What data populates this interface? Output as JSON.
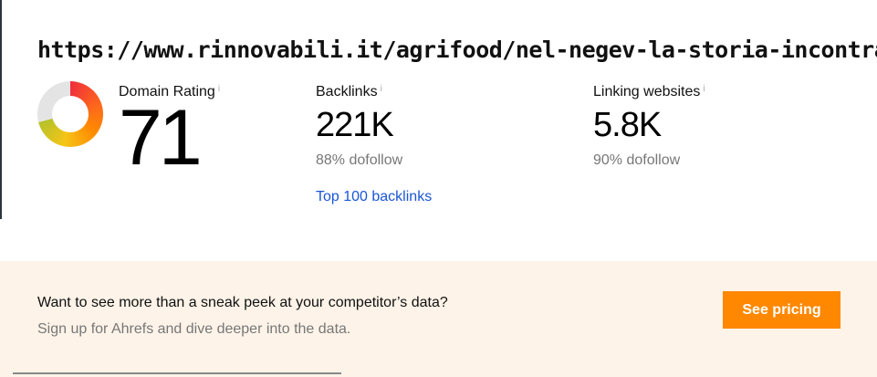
{
  "url": "https://www.rinnovabili.it/agrifood/nel-negev-la-storia-incontra-l",
  "domain_rating": {
    "label": "Domain Rating",
    "info": "i",
    "value": "71",
    "gauge_percent": 71
  },
  "backlinks": {
    "label": "Backlinks",
    "info": "i",
    "value": "221K",
    "sub": "88% dofollow",
    "link": "Top 100 backlinks"
  },
  "linking_websites": {
    "label": "Linking websites",
    "info": "i",
    "value": "5.8K",
    "sub": "90% dofollow"
  },
  "banner": {
    "title": "Want to see more than a sneak peek at your competitor’s data?",
    "subtitle": "Sign up for Ahrefs and dive deeper into the data.",
    "button": "See pricing"
  },
  "colors": {
    "accent": "#ff8800",
    "link": "#1a56d6",
    "banner_bg": "#fdf3e8"
  }
}
